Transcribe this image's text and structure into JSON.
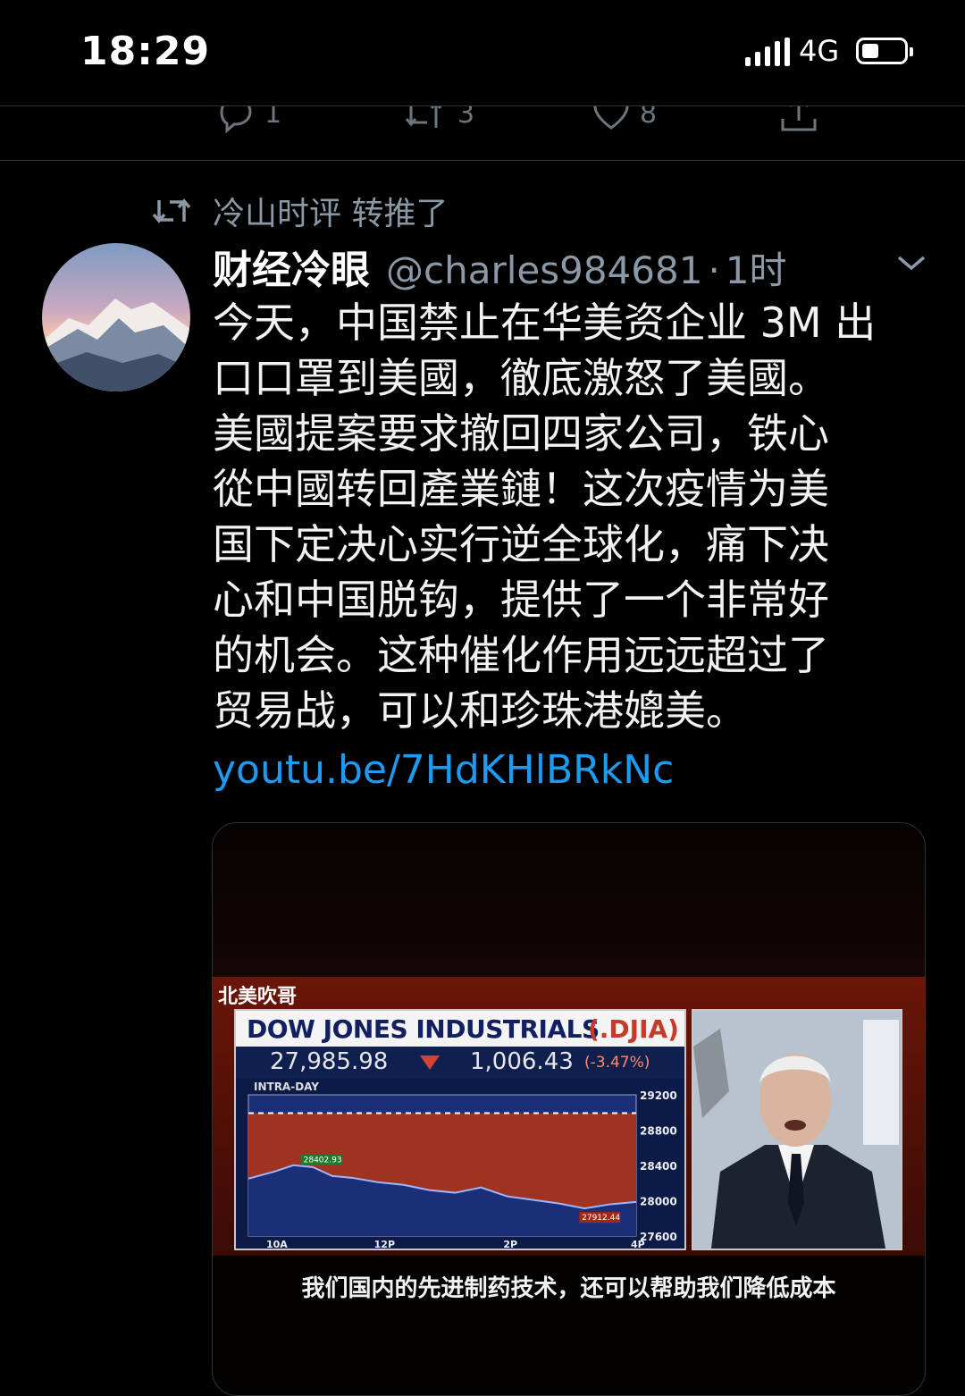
{
  "status_bar": {
    "time": "18:29",
    "network": "4G"
  },
  "prev_tweet_actions": {
    "reply_count": "1",
    "retweet_count": "3",
    "like_count": "8"
  },
  "tweet": {
    "retweeted_by": "冷山时评 转推了",
    "display_name": "财经冷眼",
    "handle": "@charles984681",
    "separator": "·",
    "time_ago": "1时",
    "text_lines": [
      "今天，中国禁止在华美资企业 3M 出",
      "口口罩到美國，徹底激怒了美國。",
      "美國提案要求撤回四家公司，铁心",
      "從中國转回產業鏈！这次疫情为美",
      "国下定决心实行逆全球化，痛下决",
      "心和中国脱钩，提供了一个非常好",
      "的机会。这种催化作用远远超过了",
      "贸易战，可以和珍珠港媲美。"
    ],
    "link": "youtu.be/7HdKHlBRkNc"
  },
  "video_card": {
    "watermark": "北美吹哥",
    "ticker_title": "DOW JONES INDUSTRIALS",
    "ticker_symbol": "(.DJIA)",
    "price": "27,985.98",
    "change": "1,006.43",
    "change_pct": "(-3.47%)",
    "subtitle": "我们国内的先进制药技术，还可以帮助我们降低成本"
  },
  "chart_data": {
    "type": "area",
    "title": "INTRA-DAY",
    "x_ticks": [
      "10A",
      "12P",
      "2P",
      "4P"
    ],
    "y_ticks": [
      "29200",
      "28800",
      "28400",
      "28000",
      "27600"
    ],
    "ylim": [
      27600,
      29200
    ],
    "high_label": "28402.93",
    "low_label": "27912.44",
    "reference_value": 28992,
    "x": [
      0,
      0.2,
      0.35,
      0.5,
      0.65,
      0.8,
      1.0,
      1.2,
      1.4,
      1.6,
      1.8,
      2.0,
      2.2,
      2.4,
      2.6,
      2.8,
      3.0,
      3.1
    ],
    "values": [
      28250,
      28330,
      28402.93,
      28380,
      28280,
      28260,
      28210,
      28180,
      28120,
      28090,
      28150,
      28050,
      28010,
      27970,
      27912.44,
      27960,
      27985.98,
      27985.98
    ]
  },
  "colors": {
    "background": "#000000",
    "link": "#1d9bf0",
    "muted": "#8b98a5"
  }
}
